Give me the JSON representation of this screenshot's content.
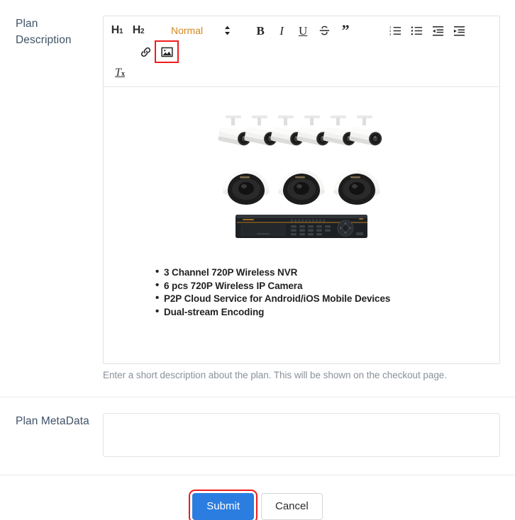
{
  "form": {
    "description_field": {
      "label": "Plan Description",
      "help_text": "Enter a short description about the plan. This will be shown on the checkout page."
    },
    "metadata_field": {
      "label": "Plan MetaData",
      "value": "",
      "placeholder": ""
    }
  },
  "editor": {
    "toolbar": {
      "heading1": "H",
      "heading1_sub": "1",
      "heading2": "H",
      "heading2_sub": "2",
      "format_picker_value": "Normal",
      "bold": "B",
      "italic": "I",
      "underline": "U",
      "strikethrough": "S",
      "blockquote": "”",
      "clear_format": "T",
      "clear_format_sub": "x",
      "icons": {
        "ordered_list": "ordered-list-icon",
        "bullet_list": "bullet-list-icon",
        "outdent": "outdent-icon",
        "indent": "indent-icon",
        "link": "link-icon",
        "image": "image-icon",
        "picker_arrows": "chevron-updown-icon"
      }
    },
    "content": {
      "image_alt": "6 bullet cameras, 3 dome cameras and NVR recorder",
      "features": [
        "3 Channel 720P Wireless NVR",
        "6 pcs 720P Wireless IP Camera",
        "P2P Cloud Service for Android/iOS Mobile Devices",
        "Dual-stream Encoding"
      ]
    }
  },
  "actions": {
    "submit_label": "Submit",
    "cancel_label": "Cancel"
  },
  "colors": {
    "submit_blue": "#2b7de0",
    "highlight_red": "#f01c1c",
    "label_slate": "#3f5267",
    "picker_orange": "#d4891f",
    "help_gray": "#8a9199"
  }
}
